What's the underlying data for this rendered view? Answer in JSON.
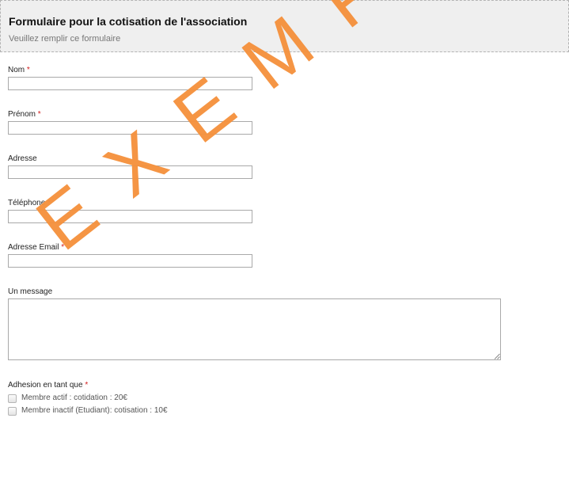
{
  "header": {
    "title": "Formulaire pour la cotisation de l'association",
    "subtitle": "Veuillez remplir ce formulaire"
  },
  "fields": {
    "nom": {
      "label": "Nom",
      "required": "*",
      "value": ""
    },
    "prenom": {
      "label": "Prénom",
      "required": "*",
      "value": ""
    },
    "adresse": {
      "label": "Adresse",
      "value": ""
    },
    "telephone": {
      "label": "Téléphone",
      "required": "*",
      "value": ""
    },
    "email": {
      "label": "Adresse Email",
      "required": "*",
      "value": ""
    },
    "message": {
      "label": "Un message",
      "value": ""
    }
  },
  "adhesion": {
    "label": "Adhesion en tant que",
    "required": "*",
    "options": [
      {
        "label": "Membre actif : cotidation : 20€",
        "checked": false
      },
      {
        "label": "Membre inactif (Etudiant): cotisation : 10€",
        "checked": false
      }
    ]
  },
  "watermark": {
    "text": "EXEMPLE",
    "color": "#f5923e"
  },
  "colors": {
    "header_bg": "#efefef",
    "required_star": "#d21c1c",
    "input_border": "#a9a9a9"
  }
}
